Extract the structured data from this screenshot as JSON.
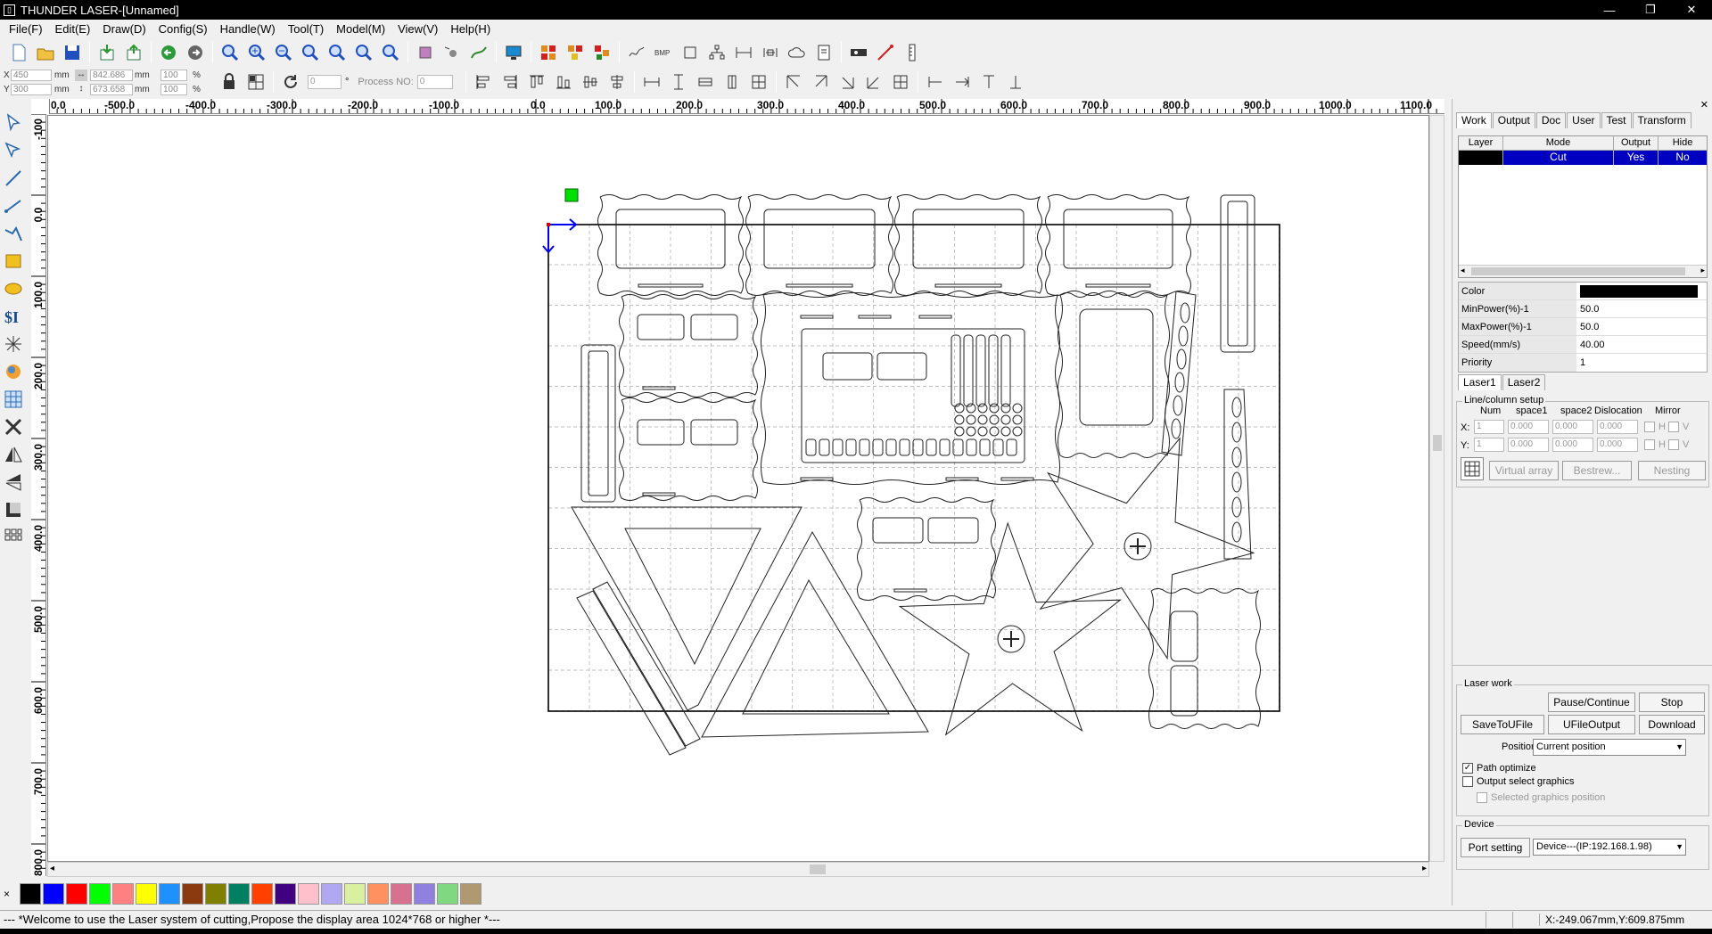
{
  "window": {
    "title": "THUNDER LASER-[Unnamed]"
  },
  "menu": [
    "File(F)",
    "Edit(E)",
    "Draw(D)",
    "Config(S)",
    "Handle(W)",
    "Tool(T)",
    "Model(M)",
    "View(V)",
    "Help(H)"
  ],
  "coords": {
    "x_label": "X",
    "y_label": "Y",
    "x_val": "450",
    "y_val": "300",
    "unit": "mm",
    "w_val": "842.686",
    "h_val": "673.658",
    "pct1": "100",
    "pct2": "100",
    "pct_unit": "%",
    "angle": "0",
    "deg": "°",
    "process_label": "Process NO:",
    "process_val": "0"
  },
  "ruler_h": [
    "0.0",
    "-500.0",
    "-400.0",
    "-300.0",
    "-200.0",
    "-100.0",
    "0.0",
    "100.0",
    "200.0",
    "300.0",
    "400.0",
    "500.0",
    "600.0",
    "700.0",
    "800.0",
    "900.0",
    "1000.0",
    "1100.0"
  ],
  "ruler_v": [
    "-100",
    "0.0",
    "100.0",
    "200.0",
    "300.0",
    "400.0",
    "500.0",
    "600.0",
    "700.0",
    "800.0"
  ],
  "palette": [
    "#000000",
    "#0000ff",
    "#ff0000",
    "#00ff00",
    "#ff8080",
    "#ffff00",
    "#1e90ff",
    "#8b3a0f",
    "#808000",
    "#008060",
    "#ff4000",
    "#400080",
    "#ffc0cb",
    "#b0a8f0",
    "#d8f0a0",
    "#ff9060",
    "#d87090",
    "#9080e0",
    "#80d880",
    "#b09870"
  ],
  "status": {
    "message": "--- *Welcome to use the Laser system of cutting,Propose the display area 1024*768 or higher *---",
    "position": "X:-249.067mm,Y:609.875mm"
  },
  "panel": {
    "tabs": [
      "Work",
      "Output",
      "Doc",
      "User",
      "Test",
      "Transform"
    ],
    "layer_headers": [
      "Layer",
      "Mode",
      "Output",
      "Hide"
    ],
    "layers": [
      {
        "mode": "Cut",
        "output": "Yes",
        "hide": "No",
        "color": "#000000"
      }
    ],
    "props": [
      {
        "k": "Color",
        "v": ""
      },
      {
        "k": "MinPower(%)-1",
        "v": "50.0"
      },
      {
        "k": "MaxPower(%)-1",
        "v": "50.0"
      },
      {
        "k": "Speed(mm/s)",
        "v": "40.00"
      },
      {
        "k": "Priority",
        "v": "1"
      }
    ],
    "laser_tabs": [
      "Laser1",
      "Laser2"
    ],
    "array": {
      "title": "Line/column setup",
      "headers": [
        "Num",
        "space1",
        "space2",
        "Dislocation",
        "Mirror"
      ],
      "x_label": "X:",
      "y_label": "Y:",
      "num": "1",
      "space1": "0.000",
      "space2": "0.000",
      "dislocation": "0.000",
      "h": "H",
      "v": "V",
      "virtual_array": "Virtual array",
      "bestrew": "Bestrew...",
      "nesting": "Nesting"
    },
    "laserwork": {
      "title": "Laser work",
      "pause": "Pause/Continue",
      "stop": "Stop",
      "save_u": "SaveToUFile",
      "ufile_out": "UFileOutput",
      "download": "Download",
      "position_label": "Position:",
      "position_val": "Current position",
      "path_opt": "Path optimize",
      "out_sel": "Output select graphics",
      "sel_pos": "Selected graphics position"
    },
    "device": {
      "title": "Device",
      "port": "Port setting",
      "device_val": "Device---(IP:192.168.1.98)"
    }
  }
}
